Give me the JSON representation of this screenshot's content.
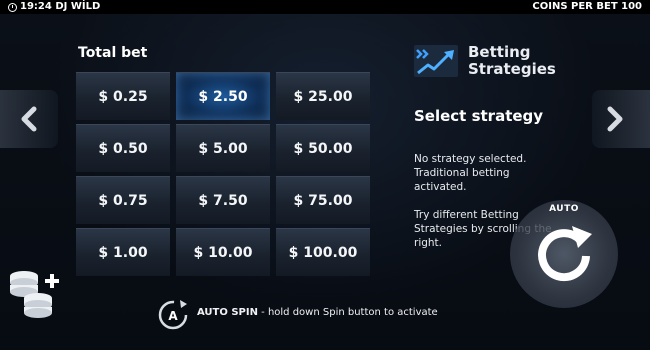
{
  "topbar": {
    "time_game": "19:24 DJ WİLD",
    "coins_per_bet": "COINS PER BET 100"
  },
  "total_bet": {
    "title": "Total bet",
    "options": [
      "$ 0.25",
      "$ 2.50",
      "$ 25.00",
      "$ 0.50",
      "$ 5.00",
      "$ 50.00",
      "$ 0.75",
      "$ 7.50",
      "$ 75.00",
      "$ 1.00",
      "$ 10.00",
      "$ 100.00"
    ],
    "selected": "$ 2.50"
  },
  "strategies": {
    "title_line1": "Betting",
    "title_line2": "Strategies",
    "select_label": "Select strategy",
    "status_text": "No strategy selected. Traditional betting activated.",
    "hint_text": "Try different Betting Strategies by scrolling the right."
  },
  "auto_button": {
    "label": "AUTO"
  },
  "bottom_hint": {
    "strong": "AUTO SPIN",
    "rest": " - hold down Spin button to activate",
    "icon_letter": "A"
  },
  "icons": {
    "left_arrow": "chevron-left-icon",
    "right_arrow": "chevron-right-icon",
    "coins": "coins-plus-icon",
    "clock": "clock-icon",
    "strategy_logo": "trend-chart-icon",
    "auto": "refresh-icon"
  },
  "colors": {
    "background": "#070b12",
    "selected_bet": "#1e5a9a",
    "bet_tile": "#1a222e",
    "accent_blue": "#2f8be0"
  }
}
